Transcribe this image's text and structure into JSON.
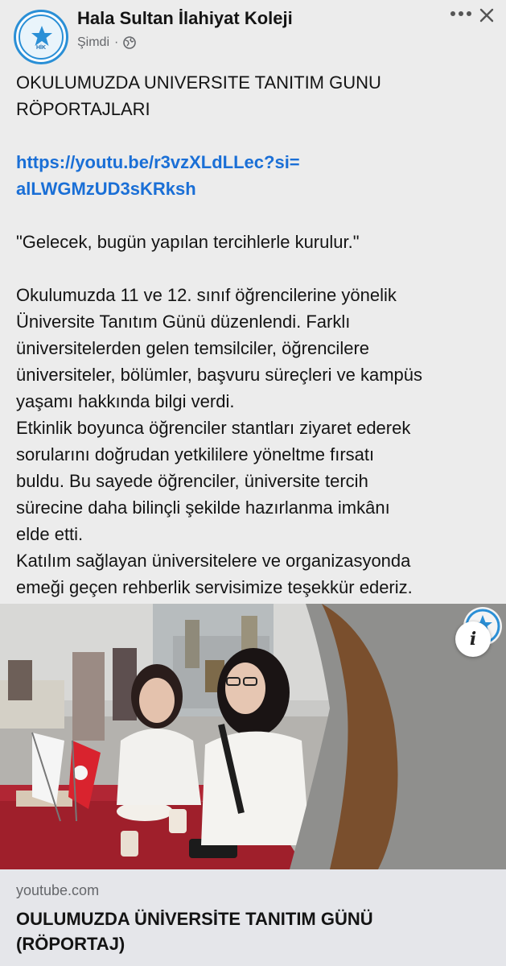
{
  "header": {
    "page_name": "Hala Sultan İlahiyat Koleji",
    "avatar_text": "HALA SULTAN İLAHİYAT KOLEJİ",
    "avatar_abbr": "HİK",
    "timestamp": "Şimdi",
    "separator": "·",
    "audience_icon": "globe-icon"
  },
  "post": {
    "title_lines": [
      "OKULUMUZDA UNIVERSITE TANITIM GUNU",
      "RÖPORTAJLARI"
    ],
    "link_lines": [
      "https://youtu.be/r3vzXLdLLec?si=",
      "alLWGMzUD3sKRksh"
    ],
    "quote": "\"Gelecek, bugün yapılan tercihlerle kurulur.\"",
    "body_lines": [
      "Okulumuzda 11 ve 12. sınıf öğrencilerine yönelik",
      "Üniversite Tanıtım Günü düzenlendi. Farklı",
      "üniversitelerden gelen temsilciler, öğrencilere",
      "üniversiteler, bölümler, başvuru süreçleri ve kampüs",
      "yaşamı hakkında bilgi verdi.",
      "Etkinlik boyunca öğrenciler stantları ziyaret ederek",
      "sorularını doğrudan yetkililere yöneltme fırsatı",
      "buldu. Bu sayede öğrenciler, üniversite tercih",
      "sürecine daha bilinçli şekilde hazırlanma imkânı",
      "elde etti.",
      "Katılım sağlayan üniversitelere ve organizasyonda",
      "emeği geçen rehberlik servisimize teşekkür ederiz."
    ]
  },
  "link_preview": {
    "info_label": "i",
    "domain": "youtube.com",
    "title_lines": [
      "OULUMUZDA ÜNİVERSİTE TANITIM GÜNÜ",
      "(RÖPORTAJ)"
    ]
  },
  "colors": {
    "background": "#ececec",
    "link": "#1a6fd6",
    "card": "#e5e6ea",
    "brand": "#2a8fd6"
  }
}
